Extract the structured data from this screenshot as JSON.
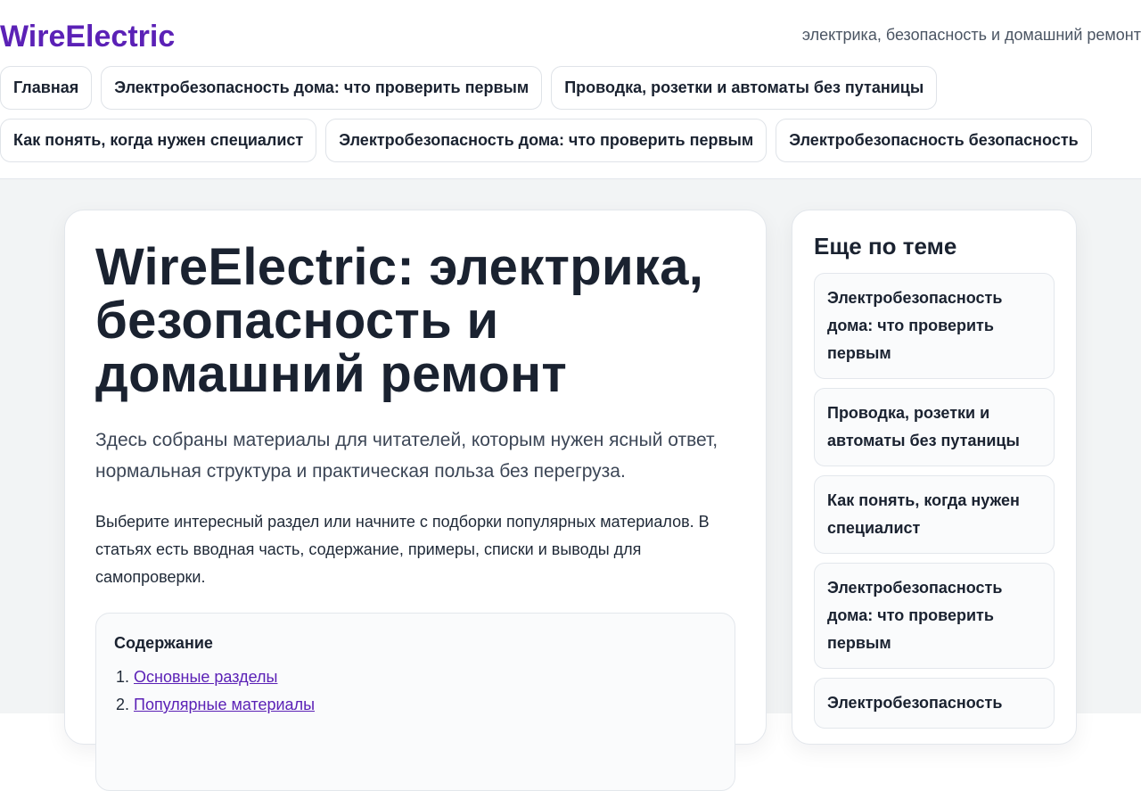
{
  "header": {
    "brand": "WireElectric",
    "tagline": "электрика, безопасность и домашний ремонт"
  },
  "nav": {
    "row1": [
      "Главная",
      "Электробезопасность дома: что проверить первым",
      "Проводка, розетки и автоматы без путаницы"
    ],
    "row2": [
      "Как понять, когда нужен специалист",
      "Электробезопасность дома: что проверить первым",
      "Электробезопасность безопасность"
    ]
  },
  "main": {
    "title": "WireElectric: электрика, безопасность и домашний ремонт",
    "lead": "Здесь собраны материалы для читателей, которым нужен ясный ответ, нормальная структура и практическая польза без перегруза.",
    "intro": "Выберите интересный раздел или начните с подборки популярных материалов. В статьях есть вводная часть, содержание, примеры, списки и выводы для самопроверки.",
    "toc": {
      "title": "Содержание",
      "items": [
        "Основные разделы",
        "Популярные материалы"
      ]
    }
  },
  "sidebar": {
    "title": "Еще по теме",
    "items": [
      "Электробезопасность дома: что проверить первым",
      "Проводка, розетки и автоматы без путаницы",
      "Как понять, когда нужен специалист",
      "Электробезопасность дома: что проверить первым",
      "Электробезопасность"
    ]
  },
  "colors": {
    "brand": "#5b21b6",
    "text": "#1a2230",
    "page_bg": "#f2f4f5"
  }
}
